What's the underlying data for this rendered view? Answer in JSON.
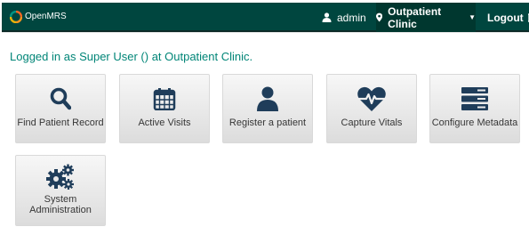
{
  "header": {
    "brand": "OpenMRS",
    "user": "admin",
    "location": "Outpatient Clinic",
    "logout": "Logout"
  },
  "welcome": "Logged in as Super User () at Outpatient Clinic.",
  "apps": [
    {
      "label": "Find Patient Record",
      "icon": "search-icon"
    },
    {
      "label": "Active Visits",
      "icon": "calendar-icon"
    },
    {
      "label": "Register a patient",
      "icon": "user-icon"
    },
    {
      "label": "Capture Vitals",
      "icon": "heartbeat-icon"
    },
    {
      "label": "Configure Metadata",
      "icon": "server-icon"
    },
    {
      "label": "System\nAdministration",
      "icon": "gears-icon"
    }
  ],
  "colors": {
    "header": "#00463f",
    "accent": "#008577",
    "tile_text": "#363636"
  }
}
